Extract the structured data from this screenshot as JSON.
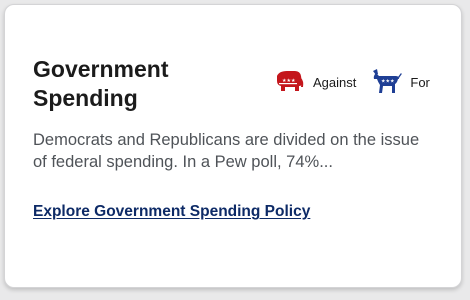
{
  "card": {
    "title": "Government Spending",
    "stances": [
      {
        "party": "republican",
        "icon": "elephant-icon",
        "label": "Against",
        "color": "#c4161c"
      },
      {
        "party": "democrat",
        "icon": "donkey-icon",
        "label": "For",
        "color": "#1f3f95"
      }
    ],
    "description": "Democrats and Republicans are divided on the issue of federal spending. In a Pew poll, 74%...",
    "link_text": "Explore Government Spending Policy"
  }
}
